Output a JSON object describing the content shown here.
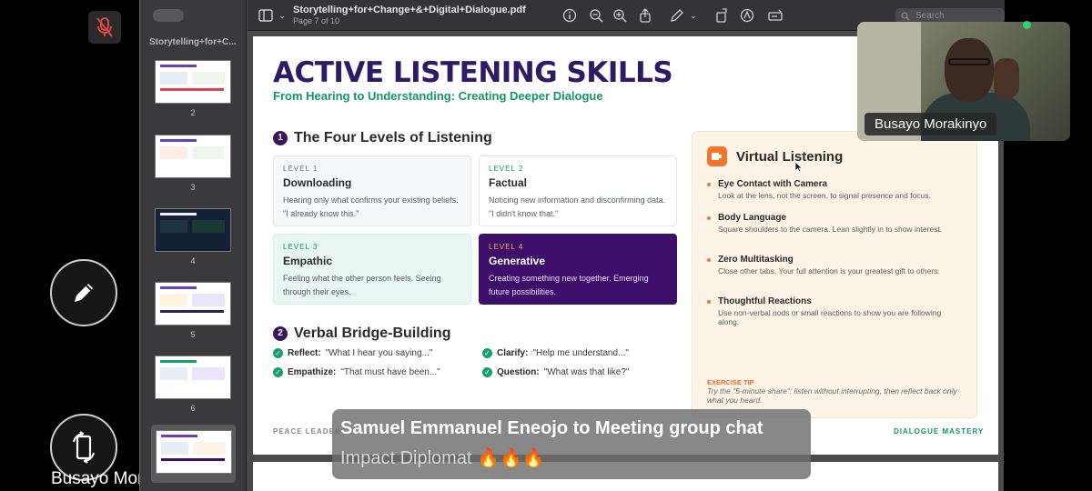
{
  "meeting": {
    "screen_label": "Busayo Morakinyo's sc",
    "mic_icon": "mic-off-icon",
    "edit_icon": "pencil-icon",
    "rotate_icon": "rotate-device-icon"
  },
  "viewer": {
    "sidebar_title": "Storytelling+for+C...",
    "thumbnails": [
      {
        "page": "2"
      },
      {
        "page": "3"
      },
      {
        "page": "4"
      },
      {
        "page": "5"
      },
      {
        "page": "6"
      }
    ],
    "active_thumbnail_page": "7",
    "document_name": "Storytelling+for+Change+&+Digital+Dialogue.pdf",
    "page_indicator": "Page 7 of 10",
    "search_placeholder": "Search"
  },
  "slide": {
    "title": "ACTIVE LISTENING SKILLS",
    "subtitle": "From Hearing to Understanding: Creating Deeper Dialogue",
    "section1": {
      "num": "1",
      "title": "The Four Levels of Listening"
    },
    "levels": [
      {
        "level": "LEVEL 1",
        "name": "Downloading",
        "desc": "Hearing only what confirms your existing beliefs. \"I already know this.\""
      },
      {
        "level": "LEVEL 2",
        "name": "Factual",
        "desc": "Noticing new information and disconfirming data. \"I didn't know that.\""
      },
      {
        "level": "LEVEL 3",
        "name": "Empathic",
        "desc": "Feeling what the other person feels. Seeing through their eyes."
      },
      {
        "level": "LEVEL 4",
        "name": "Generative",
        "desc": "Creating something new together. Emerging future possibilities."
      }
    ],
    "section2": {
      "num": "2",
      "title": "Verbal Bridge-Building"
    },
    "bridges": [
      {
        "label": "Reflect:",
        "text": "\"What I hear you saying...\""
      },
      {
        "label": "Clarify:",
        "text": "\"Help me understand...\""
      },
      {
        "label": "Empathize:",
        "text": "\"That must have been...\""
      },
      {
        "label": "Question:",
        "text": "\"What was that like?\""
      }
    ],
    "virtual": {
      "title": "Virtual Listening",
      "items": [
        {
          "title": "Eye Contact with Camera",
          "desc": "Look at the lens, not the screen, to signal presence and focus."
        },
        {
          "title": "Body Language",
          "desc": "Square shoulders to the camera. Lean slightly in to show interest."
        },
        {
          "title": "Zero Multitasking",
          "desc": "Close other tabs. Your full attention is your greatest gift to others."
        },
        {
          "title": "Thoughtful Reactions",
          "desc": "Use non-verbal nods or small reactions to show you are following along."
        }
      ],
      "exercise_label": "EXERCISE TIP",
      "exercise_text": "Try the \"5-minute share\": listen without interrupting, then reflect back only what you heard."
    },
    "footer_left": "PEACE LEADERS",
    "footer_right": "DIALOGUE MASTERY"
  },
  "participant": {
    "name": "Busayo Morakinyo"
  },
  "toast": {
    "title": "Samuel Emmanuel Eneojo to Meeting group chat",
    "message": "Impact Diplomat 🔥🔥🔥"
  }
}
